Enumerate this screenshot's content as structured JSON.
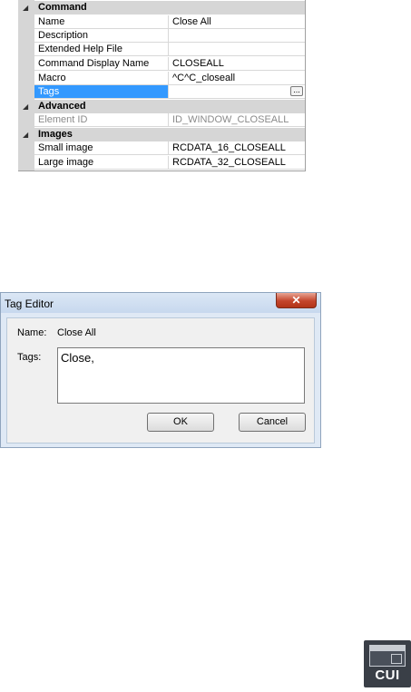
{
  "property_grid": {
    "categories": [
      {
        "label": "Command",
        "rows": [
          {
            "name": "Name",
            "value": "Close All"
          },
          {
            "name": "Description",
            "value": ""
          },
          {
            "name": "Extended Help File",
            "value": ""
          },
          {
            "name": "Command Display Name",
            "value": "CLOSEALL"
          },
          {
            "name": "Macro",
            "value": "^C^C_closeall"
          },
          {
            "name": "Tags",
            "value": "",
            "selected": true,
            "browse_button": "..."
          }
        ]
      },
      {
        "label": "Advanced",
        "rows": [
          {
            "name": "Element ID",
            "value": "ID_WINDOW_CLOSEALL",
            "readonly": true
          }
        ]
      },
      {
        "label": "Images",
        "rows": [
          {
            "name": "Small image",
            "value": "RCDATA_16_CLOSEALL"
          },
          {
            "name": "Large image",
            "value": "RCDATA_32_CLOSEALL"
          }
        ]
      }
    ],
    "collapse_glyph": "◢"
  },
  "dialog": {
    "title": "Tag Editor",
    "close_glyph": "✕",
    "name_label": "Name:",
    "name_value": "Close All",
    "tags_label": "Tags:",
    "tags_value": "Close,",
    "ok_label": "OK",
    "cancel_label": "Cancel"
  },
  "cui_icon": {
    "label": "CUI"
  }
}
